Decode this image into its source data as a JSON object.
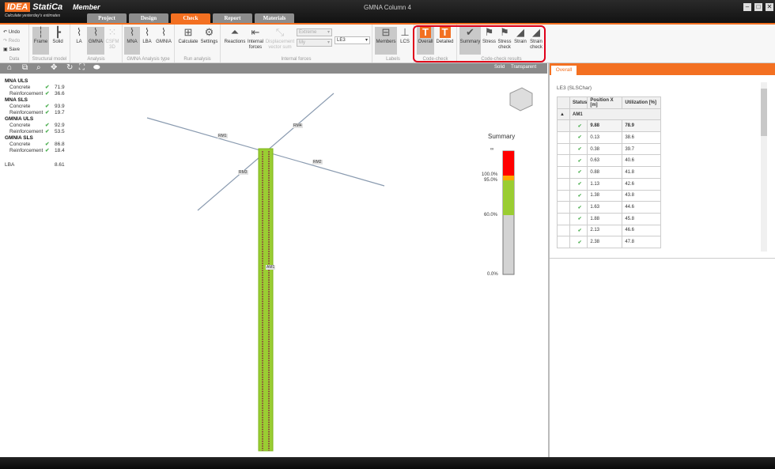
{
  "app": {
    "brand": "IDEA",
    "brand2": "StatiCa",
    "tagline": "Calculate yesterday's estimates",
    "product": "Member",
    "window_title": "GMNA Column 4"
  },
  "tabs": [
    {
      "label": "Project"
    },
    {
      "label": "Design"
    },
    {
      "label": "Check",
      "active": true
    },
    {
      "label": "Report"
    },
    {
      "label": "Materials"
    }
  ],
  "ribbon": {
    "data": {
      "label": "Data",
      "undo": "Undo",
      "redo": "Redo",
      "save": "Save"
    },
    "structural_model": {
      "label": "Structural model",
      "frame": "Frame",
      "solid": "Solid"
    },
    "analysis": {
      "label": "Analysis",
      "la": "LA",
      "gmna": "GMNA",
      "csfm": "CSFM 3D"
    },
    "gmna_type": {
      "label": "GMNA Analysis type",
      "mna": "MNA",
      "lba": "LBA",
      "gmnia": "GMNIA"
    },
    "run": {
      "label": "Run analysis",
      "calculate": "Calculate",
      "settings": "Settings"
    },
    "internal_forces": {
      "label": "Internal forces",
      "reactions": "Reactions",
      "internal": "Internal forces",
      "displacement": "Displacement vector sum",
      "extreme": "Extreme",
      "component": "My",
      "load": "LE3"
    },
    "labels": {
      "label": "Labels",
      "members": "Members",
      "lcs": "LCS"
    },
    "code_check": {
      "label": "Code-check",
      "overall": "Overall",
      "detailed": "Detailed"
    },
    "code_check_results": {
      "label": "Code-check results",
      "summary": "Summary",
      "stress": "Stress",
      "stress_check": "Stress check",
      "strain": "Strain",
      "strain_check": "Strain check"
    }
  },
  "viewport": {
    "modes": [
      "Solid",
      "Transparent"
    ],
    "results": [
      {
        "header": "MNA ULS",
        "rows": [
          {
            "name": "Concrete",
            "value": "71.9"
          },
          {
            "name": "Reinforcement",
            "value": "36.6"
          }
        ]
      },
      {
        "header": "MNA SLS",
        "rows": [
          {
            "name": "Concrete",
            "value": "93.9"
          },
          {
            "name": "Reinforcement",
            "value": "19.7"
          }
        ]
      },
      {
        "header": "GMNIA ULS",
        "rows": [
          {
            "name": "Concrete",
            "value": "92.9"
          },
          {
            "name": "Reinforcement",
            "value": "53.5"
          }
        ]
      },
      {
        "header": "GMNIA SLS",
        "rows": [
          {
            "name": "Concrete",
            "value": "86.8"
          },
          {
            "name": "Reinforcement",
            "value": "18.4"
          }
        ]
      }
    ],
    "lba": {
      "name": "LBA",
      "value": "8.61"
    },
    "members": [
      "RM1",
      "RM2",
      "RM3",
      "RM4",
      "AM1"
    ],
    "legend": {
      "title": "Summary",
      "ticks": [
        "∞",
        "100.0%",
        "95.0%",
        "60.0%",
        "0.0%"
      ],
      "colors": {
        "over": "#ff0000",
        "warn": "#ffa500",
        "ok": "#9acd32",
        "low": "#d3d3d3"
      }
    }
  },
  "panel": {
    "tab": "Overall",
    "caption": "LE3 (SLSChar)",
    "columns": [
      "Status",
      "Position X [m]",
      "Utilization [%]"
    ],
    "group": "AM1",
    "max": {
      "position": "9.88",
      "utilization": "78.9"
    },
    "rows": [
      [
        "0.13",
        "38.6"
      ],
      [
        "0.38",
        "39.7"
      ],
      [
        "0.63",
        "40.6"
      ],
      [
        "0.88",
        "41.8"
      ],
      [
        "1.13",
        "42.6"
      ],
      [
        "1.38",
        "43.8"
      ],
      [
        "1.63",
        "44.6"
      ],
      [
        "1.88",
        "45.8"
      ],
      [
        "2.13",
        "46.6"
      ],
      [
        "2.38",
        "47.8"
      ]
    ]
  },
  "colors": {
    "accent": "#f37021",
    "highlight": "#e0001a",
    "check": "#4caf50"
  }
}
